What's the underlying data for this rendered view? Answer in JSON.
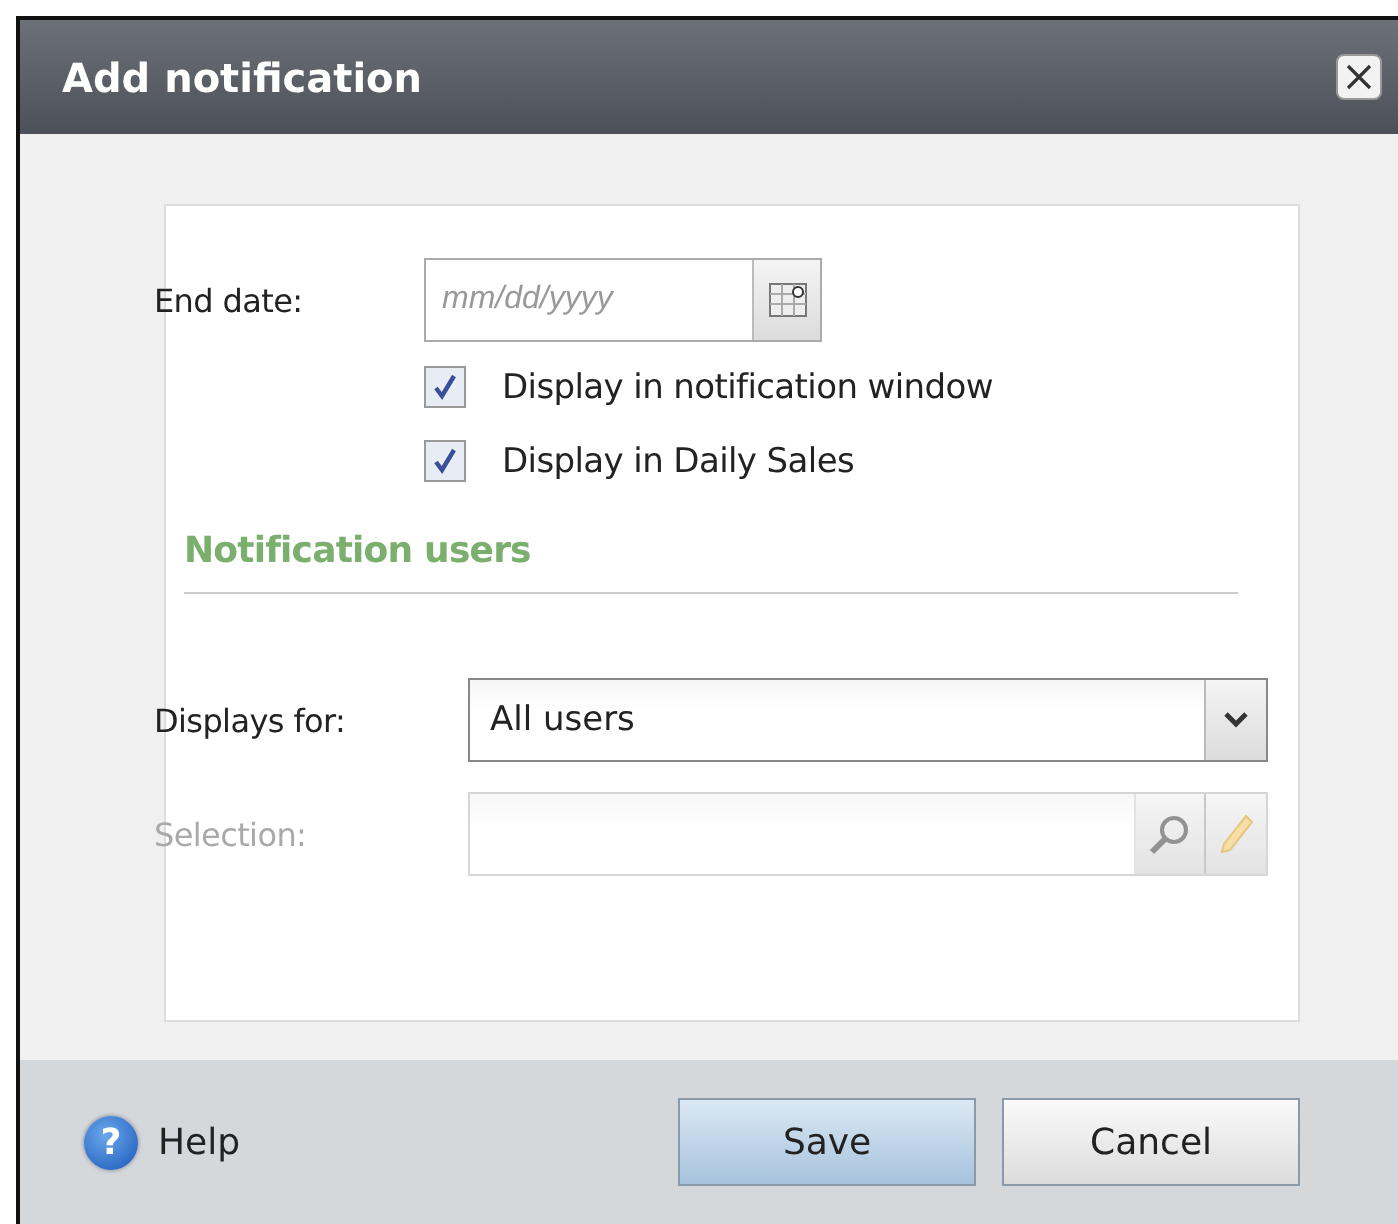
{
  "window": {
    "title": "Add notification"
  },
  "end_date": {
    "label": "End date:",
    "placeholder": "mm/dd/yyyy"
  },
  "checkboxes": [
    {
      "label": "Display in notification window",
      "checked": true
    },
    {
      "label": "Display in Daily Sales",
      "checked": true
    }
  ],
  "section": {
    "title": "Notification users"
  },
  "displays_for": {
    "label": "Displays for:",
    "value": "All users"
  },
  "selection": {
    "label": "Selection:",
    "disabled": true
  },
  "help": {
    "icon": "?",
    "label": "Help"
  },
  "buttons": [
    {
      "label": "Save",
      "kind": "primary"
    },
    {
      "label": "Cancel",
      "kind": "secondary"
    }
  ]
}
